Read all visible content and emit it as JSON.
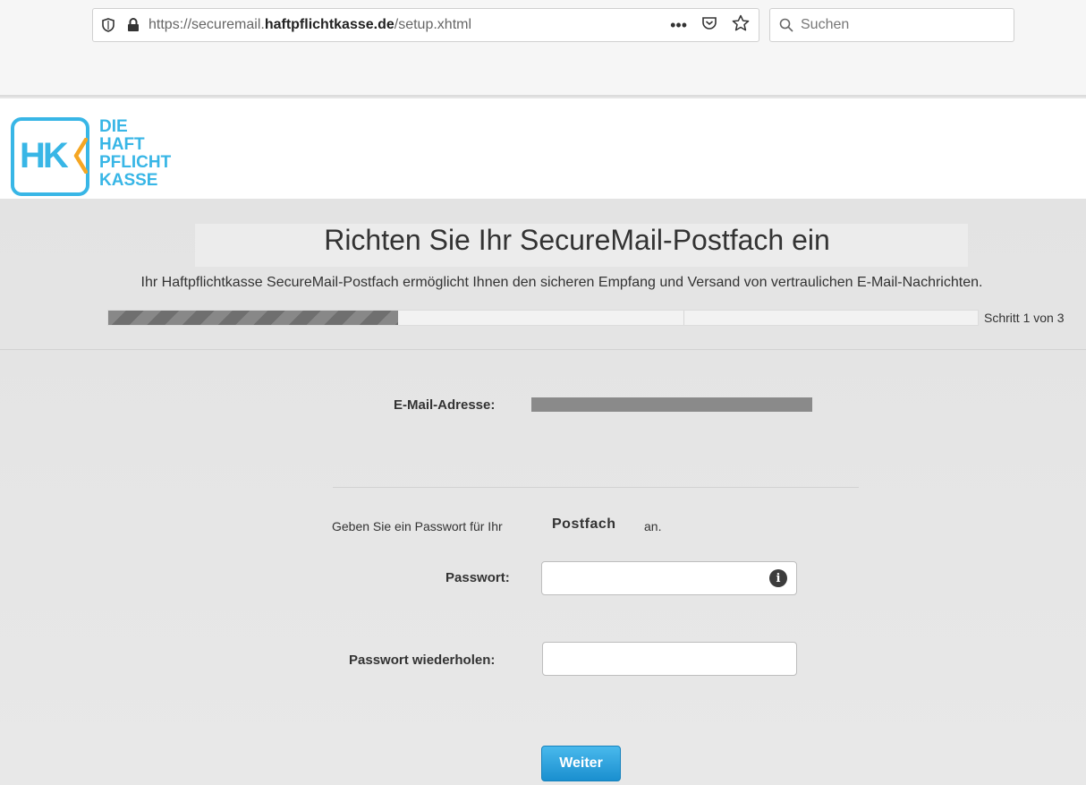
{
  "browser": {
    "url_prefix": "https://securemail.",
    "url_domain": "haftpflichtkasse.de",
    "url_path": "/setup.xhtml",
    "more_label": "•••",
    "search_placeholder": "Suchen"
  },
  "logo": {
    "mark": "HK",
    "line1": "DIE",
    "line2": "HAFT",
    "line3": "PFLICHT",
    "line4": "KASSE",
    "color": "#38b6e6",
    "accent_color": "#f5a623"
  },
  "page": {
    "title": "Richten Sie Ihr SecureMail-Postfach ein",
    "subtitle": "Ihr Haftpflichtkasse SecureMail-Postfach ermöglicht Ihnen den sicheren Empfang und Versand von vertraulichen E-Mail-Nachrichten.",
    "step_text": "Schritt 1 von 3",
    "progress_fraction": 0.333
  },
  "form": {
    "email_label": "E-Mail-Adresse:",
    "instruction_prefix": "Geben Sie ein Passwort für Ihr",
    "instruction_strong": "Postfach",
    "instruction_suffix": "an.",
    "password_label": "Passwort:",
    "password_repeat_label": "Passwort wiederholen:",
    "submit_label": "Weiter"
  }
}
